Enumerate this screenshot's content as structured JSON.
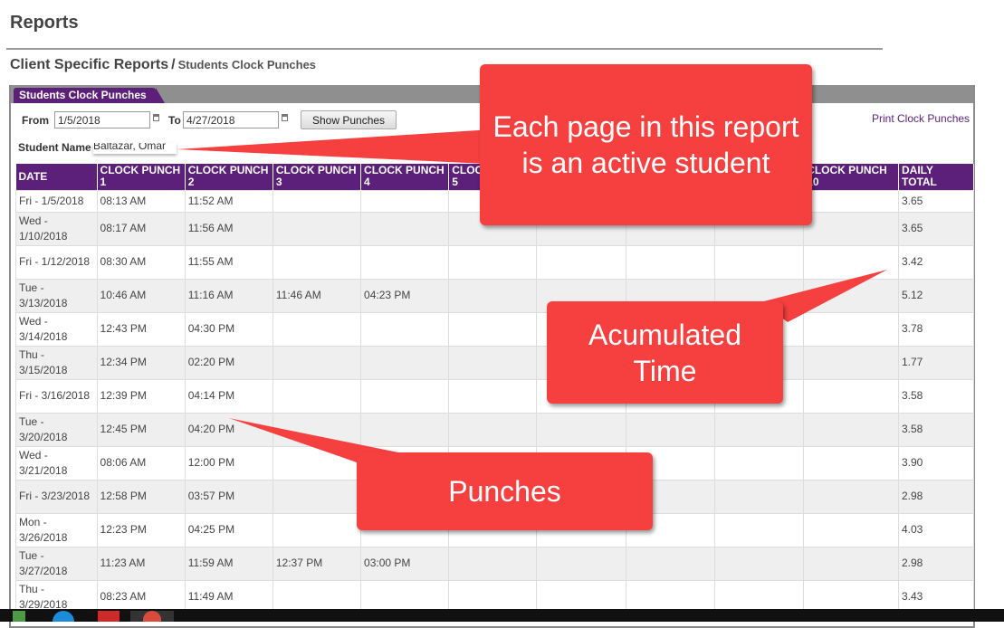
{
  "header": {
    "title": "Reports"
  },
  "breadcrumb": {
    "main": "Client Specific Reports",
    "separator": "/",
    "sub": "Students Clock Punches"
  },
  "panel": {
    "tab_label": "Students Clock Punches",
    "from_label": "From",
    "from_value": "1/5/2018",
    "to_label": "To",
    "to_value": "4/27/2018",
    "show_button": "Show Punches",
    "print_link": "Print Clock Punches",
    "student_label": "Student Name",
    "student_value": "Baltazar, Omar"
  },
  "table": {
    "headers": [
      "DATE",
      "CLOCK PUNCH 1",
      "CLOCK PUNCH 2",
      "CLOCK PUNCH 3",
      "CLOCK PUNCH 4",
      "CLOCK PUNCH 5",
      "",
      "",
      "",
      "CLOCK PUNCH 10",
      "DAILY TOTAL"
    ],
    "rows": [
      [
        "Fri - 1/5/2018",
        "08:13 AM",
        "11:52 AM",
        "",
        "",
        "",
        "",
        "",
        "",
        "",
        "3.65"
      ],
      [
        "Wed - 1/10/2018",
        "08:17 AM",
        "11:56 AM",
        "",
        "",
        "",
        "",
        "",
        "",
        "",
        "3.65"
      ],
      [
        "Fri - 1/12/2018",
        "08:30 AM",
        "11:55 AM",
        "",
        "",
        "",
        "",
        "",
        "",
        "",
        "3.42"
      ],
      [
        "Tue - 3/13/2018",
        "10:46 AM",
        "11:16 AM",
        "11:46 AM",
        "04:23 PM",
        "",
        "",
        "",
        "",
        "",
        "5.12"
      ],
      [
        "Wed - 3/14/2018",
        "12:43 PM",
        "04:30 PM",
        "",
        "",
        "",
        "",
        "",
        "",
        "",
        "3.78"
      ],
      [
        "Thu - 3/15/2018",
        "12:34 PM",
        "02:20 PM",
        "",
        "",
        "",
        "",
        "",
        "",
        "",
        "1.77"
      ],
      [
        "Fri - 3/16/2018",
        "12:39 PM",
        "04:14 PM",
        "",
        "",
        "",
        "",
        "",
        "",
        "",
        "3.58"
      ],
      [
        "Tue - 3/20/2018",
        "12:45 PM",
        "04:20 PM",
        "",
        "",
        "",
        "",
        "",
        "",
        "",
        "3.58"
      ],
      [
        "Wed - 3/21/2018",
        "08:06 AM",
        "12:00 PM",
        "",
        "",
        "",
        "",
        "",
        "",
        "",
        "3.90"
      ],
      [
        "Fri - 3/23/2018",
        "12:58 PM",
        "03:57 PM",
        "",
        "",
        "",
        "",
        "",
        "",
        "",
        "2.98"
      ],
      [
        "Mon - 3/26/2018",
        "12:23 PM",
        "04:25 PM",
        "",
        "",
        "",
        "",
        "",
        "",
        "",
        "4.03"
      ],
      [
        "Tue - 3/27/2018",
        "11:23 AM",
        "11:59 AM",
        "12:37 PM",
        "03:00 PM",
        "",
        "",
        "",
        "",
        "",
        "2.98"
      ],
      [
        "Thu - 3/29/2018",
        "08:23 AM",
        "11:49 AM",
        "",
        "",
        "",
        "",
        "",
        "",
        "",
        "3.43"
      ]
    ]
  },
  "annotations": {
    "active_student": "Each page in this report is an active student",
    "accumulated": "Acumulated Time",
    "punches": "Punches",
    "color": "#f5403f"
  },
  "colors": {
    "accent": "#5c1f7a",
    "panel_frame": "#8f8f8f"
  },
  "taskbar": {
    "icons": [
      "file-manager-icon",
      "browser-icon",
      "office-app-icon",
      "chrome-icon"
    ]
  }
}
